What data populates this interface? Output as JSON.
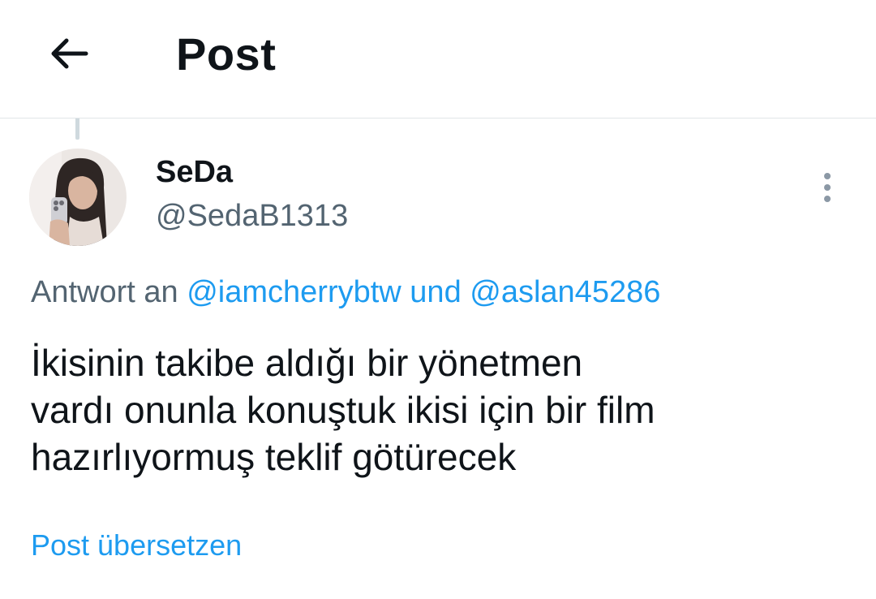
{
  "header": {
    "title": "Post",
    "back_icon": "arrow-left-icon"
  },
  "tweet": {
    "author": {
      "display_name": "SeDa",
      "handle": "@SedaB1313",
      "avatar": "avatar-photo"
    },
    "more_icon": "more-vertical-icon",
    "reply_context": {
      "prefix": "Antwort an",
      "mention_1": "@iamcherrybtw",
      "conjunction": "und",
      "mention_2": "@aslan45286"
    },
    "text_lines": [
      "İkisinin takibe aldığı bir yönetmen",
      "vardı onunla konuştuk ikisi için bir film",
      "hazırlıyormuş teklif götürecek"
    ],
    "translate_label": "Post übersetzen"
  },
  "colors": {
    "accent": "#1d9bf0",
    "text": "#0f1419",
    "secondary_text": "#536471",
    "divider": "#e1e5e8"
  }
}
